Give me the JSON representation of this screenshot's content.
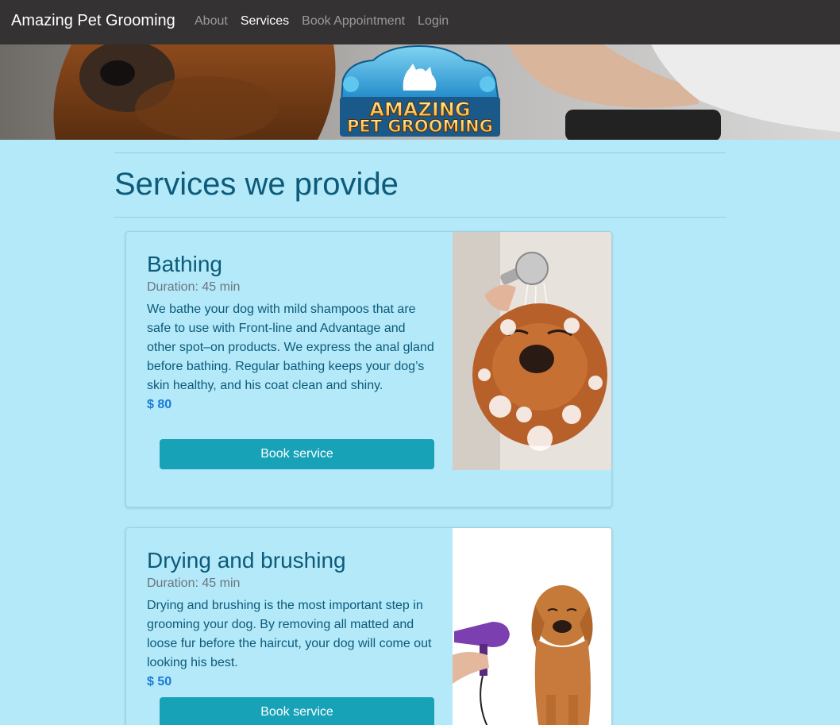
{
  "navbar": {
    "brand": "Amazing Pet Grooming",
    "links": [
      "About",
      "Services",
      "Book Appointment",
      "Login"
    ],
    "active": "Services"
  },
  "hero": {
    "logo_line1": "AMAZING",
    "logo_line2": "PET GROOMING"
  },
  "page": {
    "title": "Services we provide"
  },
  "services": [
    {
      "name": "Bathing",
      "duration": "Duration: 45 min",
      "description": "We bathe your dog with mild shampoos that are safe to use with Front-line and Advantage and other spot–on products. We express the anal gland before bathing. Regular bathing keeps your dog’s skin healthy, and his coat clean and shiny.",
      "price": "$ 80",
      "button": "Book service"
    },
    {
      "name": "Drying and brushing",
      "duration": "Duration: 45 min",
      "description": "Drying and brushing is the most important step in grooming your dog. By removing all matted and loose fur before the haircut, your dog will come out looking his best.",
      "price": "$ 50",
      "button": "Book service"
    }
  ],
  "colors": {
    "navbar_bg": "#343232",
    "page_bg": "#b3e9f9",
    "title": "#0d5a7a",
    "price": "#1a7ad4",
    "button": "#17a2b8"
  }
}
